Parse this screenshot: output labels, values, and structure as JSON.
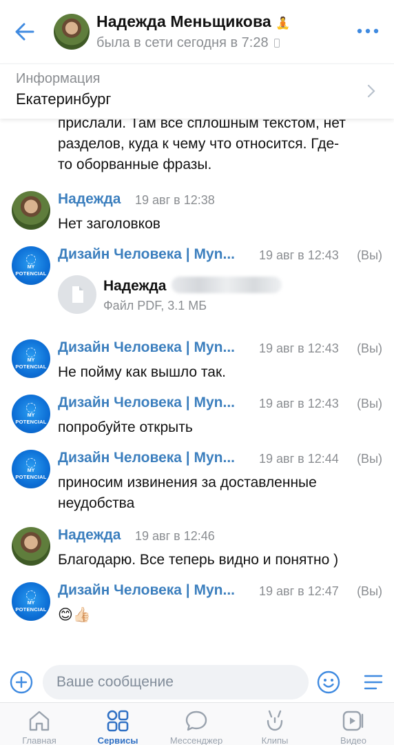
{
  "header": {
    "name": "Надежда Меньщикова",
    "name_emoji": "🧘",
    "status": "была в сети сегодня в 7:28"
  },
  "info": {
    "label": "Информация",
    "value": "Екатеринбург"
  },
  "partial_message": {
    "lines": [
      "прислали. Там все сплошным текстом, нет",
      "разделов, куда к чему что относится. Где-",
      "то оборванные фразы."
    ]
  },
  "messages": [
    {
      "author": "Надежда",
      "time": "19 авг в 12:38",
      "text": "Нет заголовков"
    },
    {
      "author": "Дизайн Человека | Myn...",
      "time": "19 авг в 12:43",
      "you": "(Вы)",
      "file_name": "Надежда",
      "file_meta": "Файл PDF, 3.1 МБ"
    },
    {
      "author": "Дизайн Человека | Myn...",
      "time": "19 авг в 12:43",
      "you": "(Вы)",
      "text": "Не пойму как вышло так."
    },
    {
      "author": "Дизайн Человека | Myn...",
      "time": "19 авг в 12:43",
      "you": "(Вы)",
      "text": "попробуйте открыть"
    },
    {
      "author": "Дизайн Человека | Myn...",
      "time": "19 авг в 12:44",
      "you": "(Вы)",
      "text_lines": [
        "приносим извинения за доставленные",
        "неудобства"
      ]
    },
    {
      "author": "Надежда",
      "time": "19 авг в 12:46",
      "text": "Благодарю. Все теперь видно и понятно )"
    },
    {
      "author": "Дизайн Человека | Myn...",
      "time": "19 авг в 12:47",
      "you": "(Вы)",
      "text": "😊👍🏻"
    }
  ],
  "brand_avatar": {
    "line1": "MY",
    "line2": "POTENCIAL"
  },
  "composer": {
    "placeholder": "Ваше сообщение"
  },
  "tabs": [
    {
      "label": "Главная"
    },
    {
      "label": "Сервисы",
      "active": true
    },
    {
      "label": "Мессенджер"
    },
    {
      "label": "Клипы"
    },
    {
      "label": "Видео"
    }
  ],
  "colors": {
    "accent": "#2f70c4",
    "author": "#3c7fbe",
    "muted": "#8a8d91"
  }
}
